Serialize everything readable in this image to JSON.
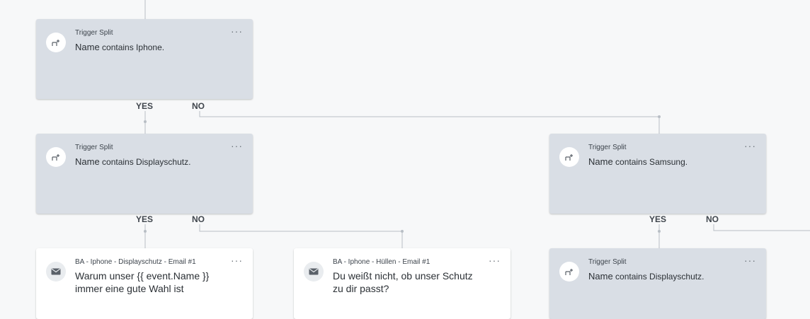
{
  "cards": [
    {
      "title": "Trigger Split",
      "keyword": "Name",
      "condition": "contains Iphone."
    },
    {
      "title": "Trigger Split",
      "keyword": "Name",
      "condition": "contains Displayschutz."
    },
    {
      "title": "Trigger Split",
      "keyword": "Name",
      "condition": "contains Samsung."
    },
    {
      "title": "BA - Iphone - Displayschutz - Email #1",
      "line1": "Warum unser {{ event.Name }}",
      "line2": "immer eine gute Wahl ist"
    },
    {
      "title": "BA - Iphone - Hüllen - Email #1",
      "line1": "Du weißt nicht, ob unser Schutz",
      "line2": "zu dir passt?"
    },
    {
      "title": "Trigger Split",
      "keyword": "Name",
      "condition": "contains Displayschutz."
    }
  ],
  "menu_dots": "···",
  "branch_labels": {
    "yes": "YES",
    "no": "NO"
  },
  "icons": {
    "split": "split-icon",
    "email": "envelope-icon",
    "menu": "ellipsis-icon"
  },
  "colors": {
    "background": "#f7f8f9",
    "split_card": "#d9dee5",
    "email_card": "#ffffff",
    "connector": "#b8bec5"
  }
}
